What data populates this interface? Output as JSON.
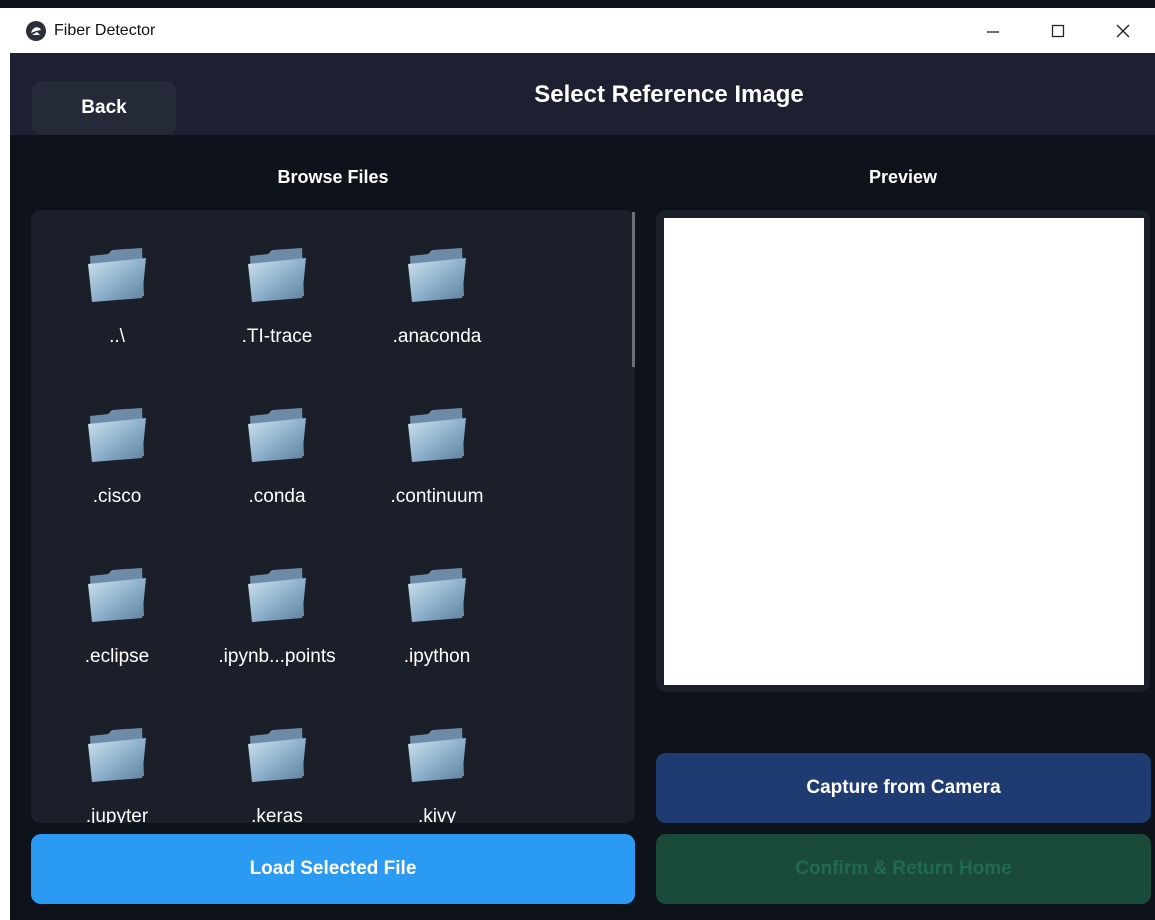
{
  "window": {
    "title": "Fiber Detector",
    "controls": [
      "minimize-icon",
      "maximize-icon",
      "close-icon"
    ]
  },
  "header": {
    "back_label": "Back",
    "title": "Select Reference Image"
  },
  "browser": {
    "label": "Browse Files",
    "items": [
      {
        "name": "..\\"
      },
      {
        "name": ".TI-trace"
      },
      {
        "name": ".anaconda"
      },
      {
        "name": ".cisco"
      },
      {
        "name": ".conda"
      },
      {
        "name": ".continuum"
      },
      {
        "name": ".eclipse"
      },
      {
        "name": ".ipynb...points"
      },
      {
        "name": ".ipython"
      },
      {
        "name": ".jupyter"
      },
      {
        "name": ".keras"
      },
      {
        "name": ".kivy"
      }
    ],
    "load_label": "Load Selected File"
  },
  "preview": {
    "label": "Preview"
  },
  "actions": {
    "capture_label": "Capture from Camera",
    "confirm_label": "Confirm & Return Home"
  },
  "colors": {
    "background": "#0e121b",
    "header": "#1c2030",
    "panel": "#1b1f2a",
    "load_button": "#2b9af3",
    "capture_button": "#1e3c72",
    "confirm_button": "#1a4a3a"
  }
}
